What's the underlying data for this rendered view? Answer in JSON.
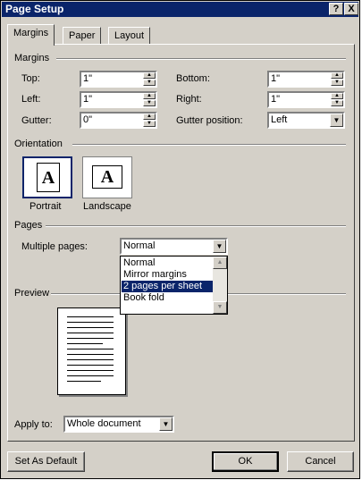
{
  "window": {
    "title": "Page Setup",
    "help_button": "?",
    "close_button": "X"
  },
  "tabs": [
    {
      "label": "Margins",
      "active": true
    },
    {
      "label": "Paper",
      "active": false
    },
    {
      "label": "Layout",
      "active": false
    }
  ],
  "margins": {
    "group_label": "Margins",
    "top_label": "Top:",
    "top_value": "1\"",
    "bottom_label": "Bottom:",
    "bottom_value": "1\"",
    "left_label": "Left:",
    "left_value": "1\"",
    "right_label": "Right:",
    "right_value": "1\"",
    "gutter_label": "Gutter:",
    "gutter_value": "0\"",
    "gutter_position_label": "Gutter position:",
    "gutter_position_value": "Left"
  },
  "orientation": {
    "group_label": "Orientation",
    "portrait_label": "Portrait",
    "landscape_label": "Landscape",
    "icon_letter": "A",
    "selected": "portrait"
  },
  "pages": {
    "group_label": "Pages",
    "multiple_pages_label": "Multiple pages:",
    "multiple_pages_value": "Normal",
    "options": [
      "Normal",
      "Mirror margins",
      "2 pages per sheet",
      "Book fold"
    ],
    "highlighted_option": "2 pages per sheet"
  },
  "preview": {
    "group_label": "Preview"
  },
  "apply_to": {
    "label": "Apply to:",
    "value": "Whole document"
  },
  "buttons": {
    "set_default": "Set As Default",
    "ok": "OK",
    "cancel": "Cancel"
  },
  "colors": {
    "face": "#d4d0c8",
    "titlebar": "#0a246a",
    "selection": "#0a246a"
  }
}
